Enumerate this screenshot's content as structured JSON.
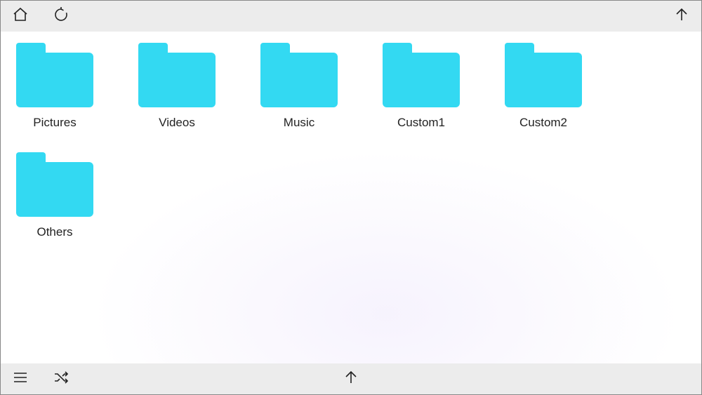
{
  "folders": [
    {
      "label": "Pictures"
    },
    {
      "label": "Videos"
    },
    {
      "label": "Music"
    },
    {
      "label": "Custom1"
    },
    {
      "label": "Custom2"
    },
    {
      "label": "Others"
    }
  ]
}
